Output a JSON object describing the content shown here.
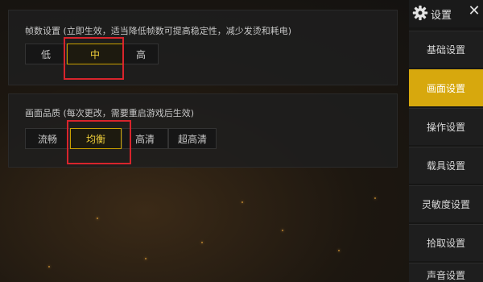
{
  "fps_section": {
    "title": "帧数设置 (立即生效，适当降低帧数可提高稳定性，减少发烫和耗电)",
    "options": [
      "低",
      "中",
      "高"
    ],
    "selected": "中"
  },
  "quality_section": {
    "title": "画面品质 (每次更改，需要重启游戏后生效)",
    "options": [
      "流畅",
      "均衡",
      "高清",
      "超高清"
    ],
    "selected": "均衡"
  },
  "header": {
    "icon": "gear-icon",
    "title": "设置",
    "close_icon": "close-icon",
    "close_glyph": "✕"
  },
  "sidebar": {
    "items": [
      {
        "label": "基础设置",
        "active": false
      },
      {
        "label": "画面设置",
        "active": true
      },
      {
        "label": "操作设置",
        "active": false
      },
      {
        "label": "载具设置",
        "active": false
      },
      {
        "label": "灵敏度设置",
        "active": false
      },
      {
        "label": "拾取设置",
        "active": false
      },
      {
        "label": "声音设置",
        "active": false
      }
    ]
  },
  "colors": {
    "accent": "#d7a80d",
    "selected_text": "#f0cf3a",
    "annotation_red": "#d8242c"
  }
}
